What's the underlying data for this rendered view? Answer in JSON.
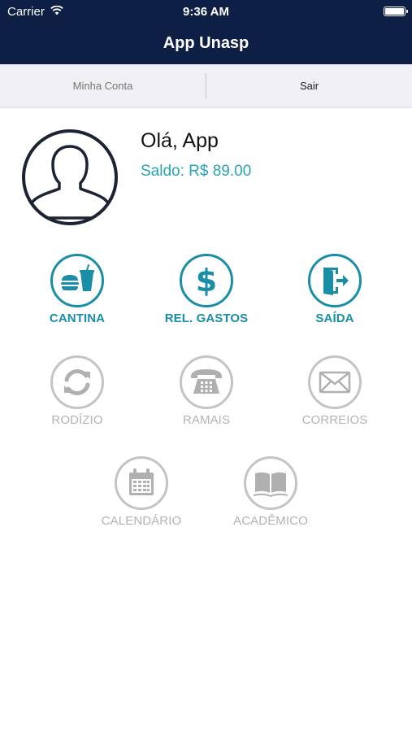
{
  "status_bar": {
    "carrier": "Carrier",
    "time": "9:36 AM"
  },
  "nav": {
    "title": "App Unasp"
  },
  "tabs": {
    "account": "Minha Conta",
    "exit": "Sair"
  },
  "profile": {
    "greeting": "Olá, App",
    "balance": "Saldo: R$ 89.00"
  },
  "menu": [
    {
      "label": "CANTINA",
      "icon": "food-icon",
      "enabled": true
    },
    {
      "label": "REL. GASTOS",
      "icon": "dollar-icon",
      "enabled": true
    },
    {
      "label": "SAÍDA",
      "icon": "exit-door-icon",
      "enabled": true
    },
    {
      "label": "RODÍZIO",
      "icon": "refresh-icon",
      "enabled": false
    },
    {
      "label": "RAMAIS",
      "icon": "telephone-icon",
      "enabled": false
    },
    {
      "label": "CORREIOS",
      "icon": "envelope-icon",
      "enabled": false
    },
    {
      "label": "CALENDÁRIO",
      "icon": "calendar-icon",
      "enabled": false
    },
    {
      "label": "ACADÊMICO",
      "icon": "book-icon",
      "enabled": false
    }
  ],
  "colors": {
    "navbar": "#0e1f45",
    "accent": "#1b8ea7",
    "disabled": "#b3b3b3"
  }
}
